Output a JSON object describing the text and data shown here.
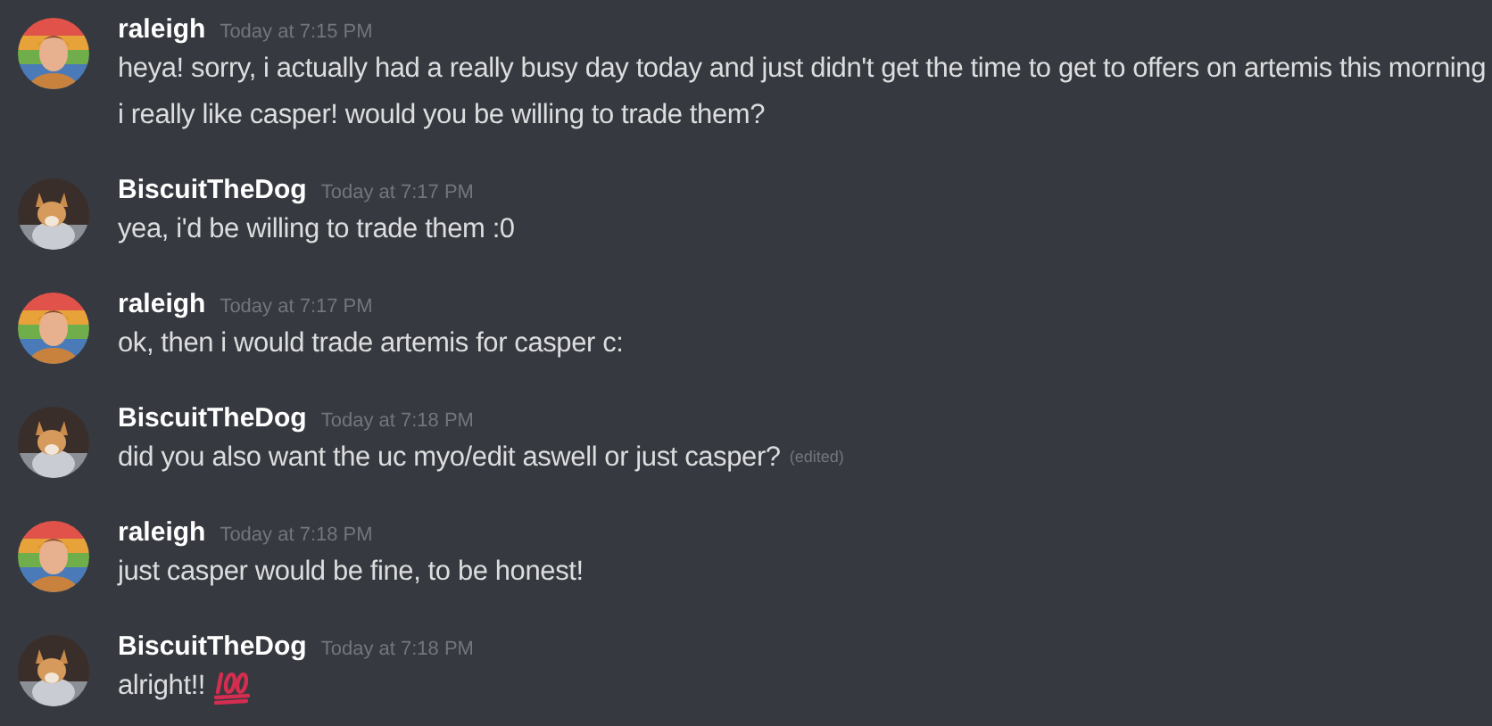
{
  "messages": [
    {
      "author": "raleigh",
      "kind": "person",
      "time": "Today at 7:15 PM",
      "lines": [
        {
          "text": "heya! sorry, i actually had a really busy day today and just didn't get the time to get to offers on artemis this morning",
          "edited": false,
          "emoji": false
        },
        {
          "text": "i really like casper! would you be willing to trade them?",
          "edited": false,
          "emoji": false
        }
      ]
    },
    {
      "author": "BiscuitTheDog",
      "kind": "dog",
      "time": "Today at 7:17 PM",
      "lines": [
        {
          "text": "yea, i'd be willing to trade them :0",
          "edited": false,
          "emoji": false
        }
      ]
    },
    {
      "author": "raleigh",
      "kind": "person",
      "time": "Today at 7:17 PM",
      "lines": [
        {
          "text": "ok, then i would trade artemis for casper c:",
          "edited": false,
          "emoji": false
        }
      ]
    },
    {
      "author": "BiscuitTheDog",
      "kind": "dog",
      "time": "Today at 7:18 PM",
      "lines": [
        {
          "text": "did you also want the uc myo/edit aswell or just casper?",
          "edited": true,
          "edited_label": "(edited)",
          "emoji": false
        }
      ]
    },
    {
      "author": "raleigh",
      "kind": "person",
      "time": "Today at 7:18 PM",
      "lines": [
        {
          "text": "just casper would be fine, to be honest!",
          "edited": false,
          "emoji": false
        }
      ]
    },
    {
      "author": "BiscuitTheDog",
      "kind": "dog",
      "time": "Today at 7:18 PM",
      "lines": [
        {
          "text": "alright!!",
          "edited": false,
          "emoji": true
        }
      ]
    }
  ]
}
